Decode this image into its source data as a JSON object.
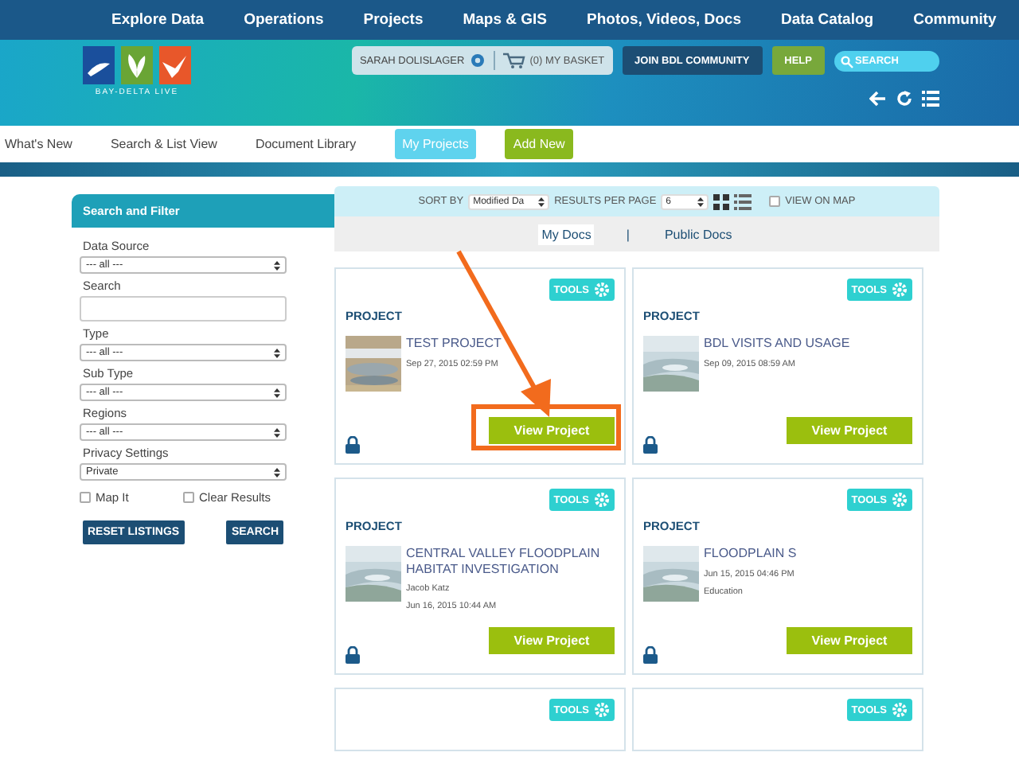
{
  "top_nav": {
    "items": [
      "Explore Data",
      "Operations",
      "Projects",
      "Maps & GIS",
      "Photos, Videos, Docs",
      "Data Catalog",
      "Community"
    ]
  },
  "header": {
    "logo_text": "BAY-DELTA LIVE",
    "user": "SARAH DOLISLAGER",
    "basket": "(0) MY BASKET",
    "join": "JOIN BDL COMMUNITY",
    "help": "HELP",
    "search_placeholder": "SEARCH"
  },
  "sub_nav": [
    {
      "label": "What's New",
      "kind": "link",
      "selected": false
    },
    {
      "label": "Search & List View",
      "kind": "link",
      "selected": false
    },
    {
      "label": "Document Library",
      "kind": "link",
      "selected": false
    },
    {
      "label": "My Projects",
      "kind": "button",
      "selected": true
    },
    {
      "label": "Add New",
      "kind": "add",
      "selected": false
    }
  ],
  "sidebar": {
    "title": "Search and Filter",
    "fields": [
      {
        "label": "Data Source",
        "kind": "select",
        "value": "--- all ---"
      },
      {
        "label": "Search",
        "kind": "text"
      },
      {
        "label": "Type",
        "kind": "select",
        "value": "--- all ---"
      },
      {
        "label": "Sub Type",
        "kind": "select",
        "value": "--- all ---"
      },
      {
        "label": "Regions",
        "kind": "select",
        "value": "--- all ---"
      },
      {
        "label": "Privacy Settings",
        "kind": "select",
        "value": "Private"
      }
    ],
    "checkboxes": [
      {
        "label": "Map It",
        "checked": false
      },
      {
        "label": "Clear Results",
        "checked": false
      }
    ],
    "buttons": [
      "RESET LISTINGS",
      "SEARCH"
    ]
  },
  "toolbar": {
    "sort_label": "SORT BY",
    "sort_value": "Modified Da",
    "per_page_label": "RESULTS PER PAGE",
    "per_page_value": "6",
    "map_label": "VIEW ON MAP",
    "map_checked": false
  },
  "doc_tabs": [
    {
      "label": "My Docs",
      "selected": true
    },
    {
      "label": "Public Docs",
      "selected": false
    }
  ],
  "doc_tab_separator": "|",
  "cards": [
    {
      "tools": "TOOLS",
      "type": "PROJECT",
      "title": "TEST PROJECT",
      "date": "Sep 27, 2015 02:59 PM",
      "button": "View Project",
      "locked": true,
      "highlighted": true
    },
    {
      "tools": "TOOLS",
      "type": "PROJECT",
      "title": "BDL VISITS AND USAGE",
      "date": "Sep 09, 2015 08:59 AM",
      "button": "View Project",
      "locked": true,
      "highlighted": false
    },
    {
      "tools": "TOOLS",
      "type": "PROJECT",
      "title": "CENTRAL VALLEY FLOODPLAIN HABITAT INVESTIGATION",
      "author": "Jacob Katz",
      "date": "Jun 16, 2015 10:44 AM",
      "button": "View Project",
      "locked": true,
      "highlighted": false
    },
    {
      "tools": "TOOLS",
      "type": "PROJECT",
      "title": "FLOODPLAIN S",
      "date": "Jun 15, 2015 04:46 PM",
      "category": "Education",
      "button": "View Project",
      "locked": true,
      "highlighted": false
    },
    {
      "tools": "TOOLS"
    },
    {
      "tools": "TOOLS"
    }
  ]
}
